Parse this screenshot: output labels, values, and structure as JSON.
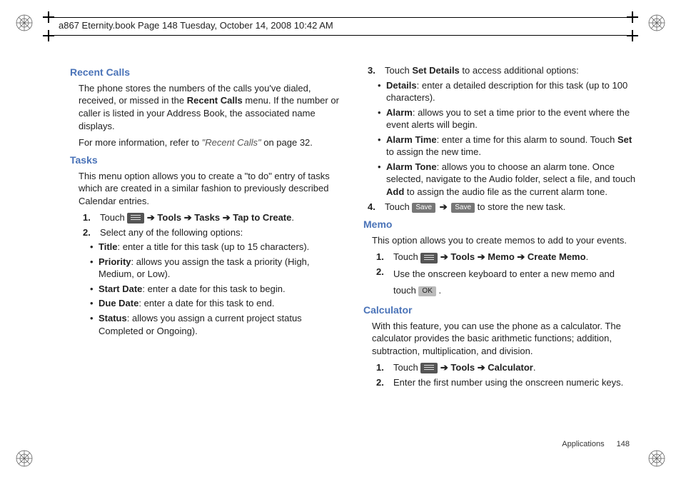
{
  "header": {
    "title": "a867 Eternity.book  Page 148  Tuesday, October 14, 2008  10:42 AM"
  },
  "left": {
    "recent": {
      "heading": "Recent Calls",
      "p1a": "The phone stores the numbers of the calls you've dialed, received, or missed in the ",
      "p1b": "Recent Calls",
      "p1c": " menu. If the number or caller is listed in your Address Book, the associated name displays.",
      "p2a": "For more information, refer to ",
      "p2b": "\"Recent Calls\"",
      "p2c": "  on page 32."
    },
    "tasks": {
      "heading": "Tasks",
      "intro": "This menu option allows you to create a \"to do\" entry of tasks which are created in a similar fashion to previously described Calendar entries.",
      "s1": {
        "num": "1.",
        "a": "Touch ",
        "path": " ➔ Tools ➔ Tasks ➔ Tap to Create",
        "dot": "."
      },
      "s2": {
        "num": "2.",
        "text": "Select any of the following options:"
      },
      "opts": {
        "title_l": "Title",
        "title_t": ": enter a title for this task (up to 15 characters).",
        "prio_l": "Priority",
        "prio_t": ": allows you assign the task a priority (High, Medium, or Low).",
        "start_l": "Start Date",
        "start_t": ": enter a date for this task to begin.",
        "due_l": "Due Date",
        "due_t": ": enter a date for this task to end.",
        "status_l": "Status",
        "status_t": ": allows you assign a current project status Completed or Ongoing)."
      }
    }
  },
  "right": {
    "tasks2": {
      "s3": {
        "num": "3.",
        "a": "Touch ",
        "b": "Set Details",
        "c": " to access additional options:"
      },
      "opts": {
        "det_l": "Details",
        "det_t": ": enter a detailed description for this task (up to 100 characters).",
        "al_l": "Alarm",
        "al_t": ": allows you to set a time prior to the event where the event alerts will begin.",
        "alt_l": "Alarm Time",
        "alt_ta": ": enter a time for this alarm to sound. Touch ",
        "alt_tb": "Set",
        "alt_tc": " to assign the new time.",
        "alto_l": "Alarm Tone",
        "alto_ta": ": allows you to choose an alarm tone. Once selected, navigate to the Audio folder, select a file, and touch ",
        "alto_tb": "Add",
        "alto_tc": " to assign the audio file as the current alarm tone."
      },
      "s4": {
        "num": "4.",
        "a": "Touch ",
        "save1": "Save",
        "arrow": " ➔ ",
        "save2": "Save",
        "c": " to store the new task."
      }
    },
    "memo": {
      "heading": "Memo",
      "intro": "This option allows you to create memos to add to your events.",
      "s1": {
        "num": "1.",
        "a": "Touch ",
        "path": " ➔ Tools ➔ Memo ➔ Create Memo",
        "dot": "."
      },
      "s2": {
        "num": "2.",
        "a": "Use the onscreen keyboard to enter a new memo and touch ",
        "ok": "OK",
        "dot": " ."
      }
    },
    "calc": {
      "heading": "Calculator",
      "intro": "With this feature, you can use the phone as a calculator. The calculator provides the basic arithmetic functions; addition, subtraction, multiplication, and division.",
      "s1": {
        "num": "1.",
        "a": "Touch ",
        "path": " ➔ Tools ➔ Calculator",
        "dot": "."
      },
      "s2": {
        "num": "2.",
        "text": "Enter the first number using the onscreen numeric keys."
      }
    }
  },
  "footer": {
    "section": "Applications",
    "page": "148"
  }
}
